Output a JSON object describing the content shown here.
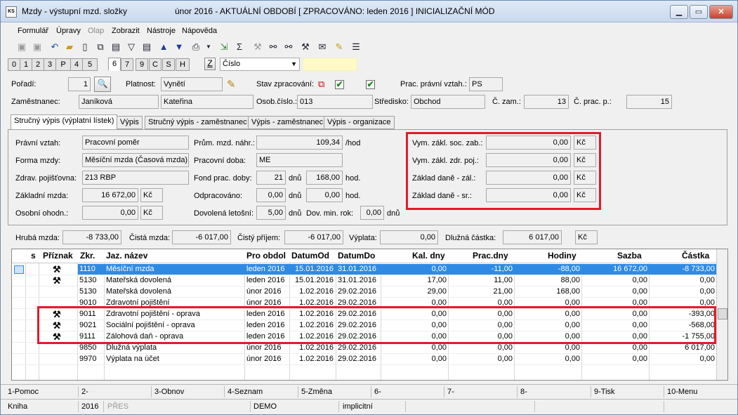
{
  "window": {
    "title": "Mzdy - výstupní mzd. složky",
    "period_title": "únor 2016 - AKTUÁLNÍ OBDOBÍ [ ZPRACOVÁNO: leden 2016 ]  INICIALIZAČNÍ MÓD",
    "app_icon_text": "KS"
  },
  "menu": [
    "Formulář",
    "Úpravy",
    "Olap",
    "Zobrazit",
    "Nástroje",
    "Nápověda"
  ],
  "num_tabs": [
    "0",
    "1",
    "2",
    "3",
    "P",
    "4",
    "5",
    "6",
    "7",
    "9",
    "C",
    "S",
    "H"
  ],
  "num_tab_active": "6",
  "toolbar_z": "Z",
  "sort_select": "Číslo",
  "form": {
    "poradi_label": "Pořadí:",
    "poradi_value": "1",
    "platnost_label": "Platnost:",
    "platnost_value": "Vynětí",
    "stav_label": "Stav zpracování:",
    "prac_vztah_label": "Prac. právní vztah.:",
    "prac_vztah_value": "PS",
    "zamestnanec_label": "Zaměstnanec:",
    "prijmeni": "Janíková",
    "jmeno": "Kateřina",
    "osob_cislo_label": "Osob.číslo.:",
    "osob_cislo_value": "013",
    "stredisko_label": "Středisko:",
    "stredisko_value": "Obchod",
    "c_zam_label": "Č. zam.:",
    "c_zam_value": "13",
    "c_prac_label": "Č. prac. p.:",
    "c_prac_value": "15"
  },
  "panel_tabs": [
    "Stručný výpis (výplatní lístek)",
    "Výpis",
    "Stručný výpis - zaměstnanec",
    "Výpis - zaměstnanec",
    "Výpis - organizace"
  ],
  "panel": {
    "pravni_vztah_label": "Právní vztah:",
    "pravni_vztah": "Pracovní poměr",
    "forma_mzdy_label": "Forma mzdy:",
    "forma_mzdy": "Měsíční mzda (Časová mzda)",
    "zdrav_poj_label": "Zdrav. pojišťovna:",
    "zdrav_poj": "213 RBP",
    "zakladni_mzda_label": "Základní mzda:",
    "zakladni_mzda": "16 672,00",
    "kc": "Kč",
    "osobni_ohodn_label": "Osobní ohodn.:",
    "osobni_ohodn": "0,00",
    "prum_label": "Prům. mzd. náhr.:",
    "prum_value": "109,34",
    "hod_unit": "/hod",
    "prac_doba_label": "Pracovní doba:",
    "prac_doba": "ME",
    "fond_label": "Fond prac. doby:",
    "fond_dny": "21",
    "dnu": "dnů",
    "fond_hod": "168,00",
    "hod": "hod.",
    "odprac_label": "Odpracováno:",
    "odprac_dny": "0,00",
    "odprac_hod": "0,00",
    "dovolena_label": "Dovolená letošní:",
    "dovolena_dny": "5,00",
    "dov_min_label": "Dov. min. rok:",
    "dov_min": "0,00",
    "vym_soc_label": "Vym. zákl. soc. zab.:",
    "vym_soc": "0,00",
    "vym_zdr_label": "Vym. zákl. zdr. poj.:",
    "vym_zdr": "0,00",
    "zakl_zal_label": "Základ daně - zál.:",
    "zakl_zal": "0,00",
    "zakl_sr_label": "Základ daně - sr.:",
    "zakl_sr": "0,00"
  },
  "summary": {
    "hruba_label": "Hrubá mzda:",
    "hruba": "-8 733,00",
    "cista_label": "Čistá mzda:",
    "cista": "-6 017,00",
    "cisty_prijem_label": "Čistý příjem:",
    "cisty_prijem": "-6 017,00",
    "vyplata_label": "Výplata:",
    "vyplata": "0,00",
    "dluzna_label": "Dlužná částka:",
    "dluzna": "6 017,00",
    "kc": "Kč"
  },
  "table": {
    "headers": [
      "s",
      "Příznak",
      "Zkr.",
      "Jaz. název",
      "Pro obdol",
      "DatumOd",
      "DatumDo",
      "Kal. dny",
      "Prac.dny",
      "Hodiny",
      "Sazba",
      "Částka"
    ],
    "rows": [
      {
        "flag": "⚒",
        "zkr": "1110",
        "nazev": "Měsíční mzda",
        "obdobi": "leden 2016",
        "od": "15.01.2016",
        "do": "31.01.2016",
        "kal": "0,00",
        "prac": "-11,00",
        "hod": "-88,00",
        "sazba": "16 672,00",
        "castka": "-8 733,00",
        "selected": true
      },
      {
        "flag": "⚒",
        "zkr": "5130",
        "nazev": "Mateřská dovolená",
        "obdobi": "leden 2016",
        "od": "15.01.2016",
        "do": "31.01.2016",
        "kal": "17,00",
        "prac": "11,00",
        "hod": "88,00",
        "sazba": "0,00",
        "castka": "0,00"
      },
      {
        "flag": "",
        "zkr": "5130",
        "nazev": "Mateřská dovolená",
        "obdobi": "únor 2016",
        "od": "1.02.2016",
        "do": "29.02.2016",
        "kal": "29,00",
        "prac": "21,00",
        "hod": "168,00",
        "sazba": "0,00",
        "castka": "0,00"
      },
      {
        "flag": "",
        "zkr": "9010",
        "nazev": "Zdravotní pojištění",
        "obdobi": "únor 2016",
        "od": "1.02.2016",
        "do": "29.02.2016",
        "kal": "0,00",
        "prac": "0,00",
        "hod": "0,00",
        "sazba": "0,00",
        "castka": "0,00"
      },
      {
        "flag": "⚒",
        "zkr": "9011",
        "nazev": "Zdravotní pojištění - oprava",
        "obdobi": "leden 2016",
        "od": "1.02.2016",
        "do": "29.02.2016",
        "kal": "0,00",
        "prac": "0,00",
        "hod": "0,00",
        "sazba": "0,00",
        "castka": "-393,00"
      },
      {
        "flag": "⚒",
        "zkr": "9021",
        "nazev": "Sociální pojištění - oprava",
        "obdobi": "leden 2016",
        "od": "1.02.2016",
        "do": "29.02.2016",
        "kal": "0,00",
        "prac": "0,00",
        "hod": "0,00",
        "sazba": "0,00",
        "castka": "-568,00"
      },
      {
        "flag": "⚒",
        "zkr": "9111",
        "nazev": "Zálohová daň - oprava",
        "obdobi": "leden 2016",
        "od": "1.02.2016",
        "do": "29.02.2016",
        "kal": "0,00",
        "prac": "0,00",
        "hod": "0,00",
        "sazba": "0,00",
        "castka": "-1 755,00"
      },
      {
        "flag": "",
        "zkr": "9850",
        "nazev": "Dlužná výplata",
        "obdobi": "únor 2016",
        "od": "1.02.2016",
        "do": "29.02.2016",
        "kal": "0,00",
        "prac": "0,00",
        "hod": "0,00",
        "sazba": "0,00",
        "castka": "6 017,00"
      },
      {
        "flag": "",
        "zkr": "9970",
        "nazev": "Výplata na účet",
        "obdobi": "únor 2016",
        "od": "1.02.2016",
        "do": "29.02.2016",
        "kal": "0,00",
        "prac": "0,00",
        "hod": "0,00",
        "sazba": "0,00",
        "castka": "0,00"
      }
    ]
  },
  "fkeys": [
    "1-Pomoc",
    "2-",
    "3-Obnov",
    "4-Seznam",
    "5-Změna",
    "6-",
    "7-",
    "8-",
    "9-Tisk",
    "10-Menu"
  ],
  "status": {
    "kniha": "Kniha",
    "rok": "2016",
    "pres": "PŘES",
    "db": "DEMO",
    "mode": "implicitní"
  },
  "colors": {
    "highlight_box": "#e31b2b",
    "selection": "#2f8ae3"
  }
}
